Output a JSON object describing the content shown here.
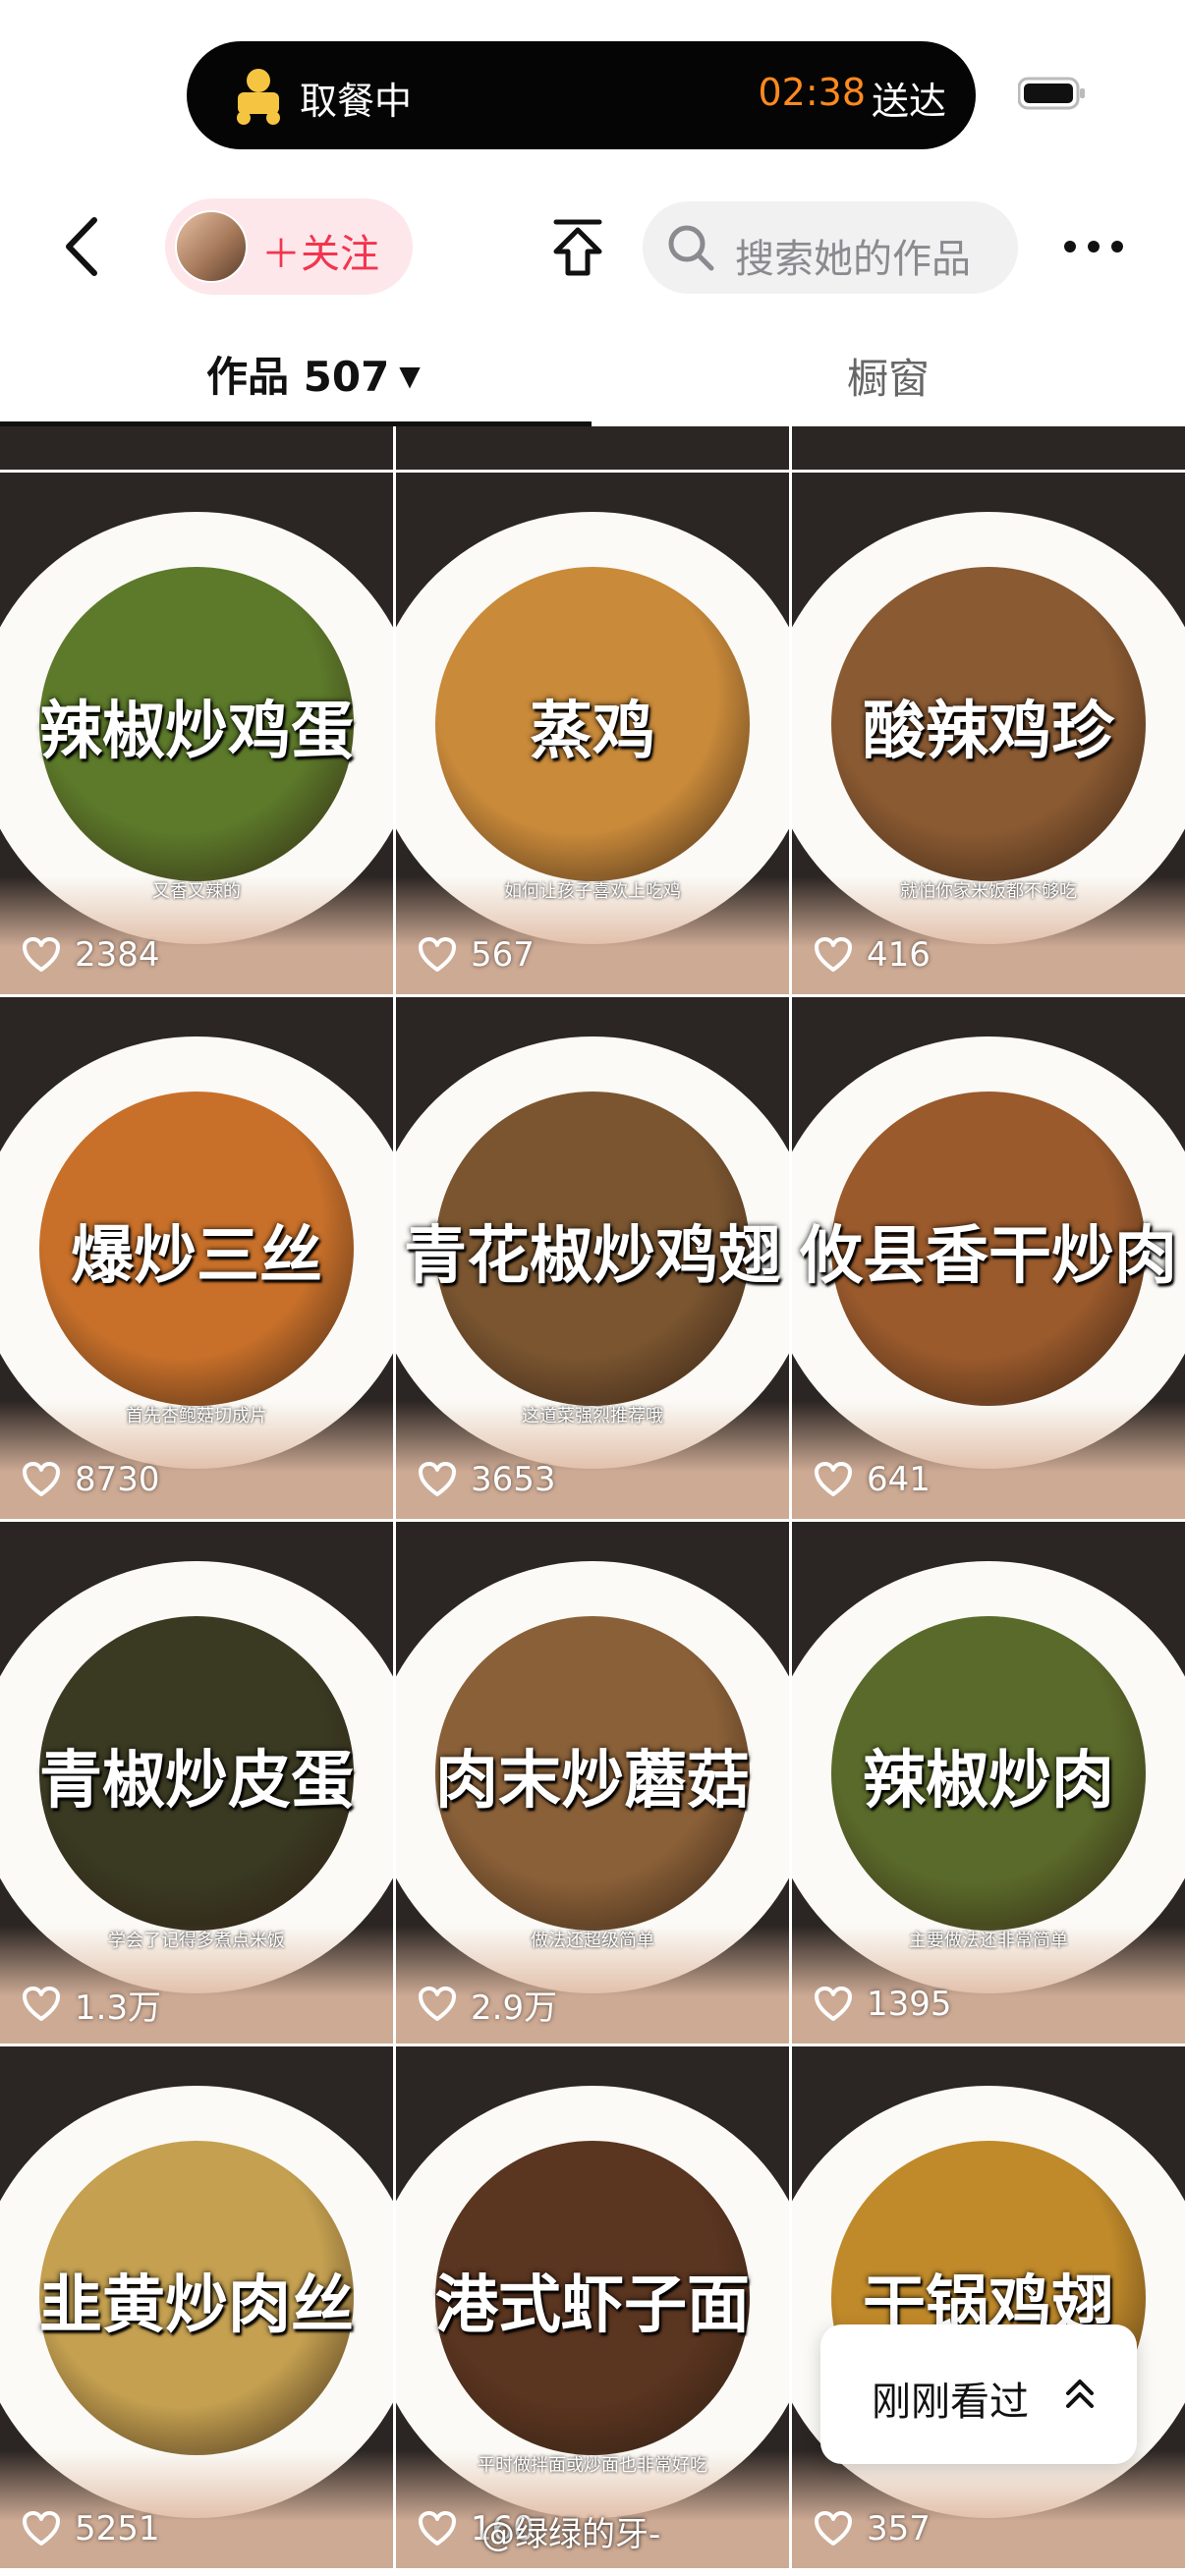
{
  "live_activity": {
    "status": "取餐中",
    "time": "02:38",
    "deliver_label": "送达",
    "time_color": "#ff8a1f"
  },
  "header": {
    "back_icon": "chevron-left-icon",
    "follow_label": "＋关注",
    "share_icon": "share-upload-icon",
    "search_placeholder": "搜索她的作品",
    "more_icon": "ellipsis-icon"
  },
  "tabs": {
    "works_label": "作品 507",
    "works_caret": "▼",
    "shop_label": "橱窗"
  },
  "videos": [
    {
      "title": "辣椒炒鸡蛋",
      "subtitle": "又香又辣的",
      "likes": "2384",
      "food_color": "#5c7a2a"
    },
    {
      "title": "蒸鸡",
      "subtitle": "如何让孩子喜欢上吃鸡",
      "likes": "567",
      "food_color": "#c98a3a"
    },
    {
      "title": "酸辣鸡珍",
      "subtitle": "就怕你家米饭都不够吃",
      "likes": "416",
      "food_color": "#8a5a32"
    },
    {
      "title": "爆炒三丝",
      "subtitle": "首先杏鲍菇切成片",
      "likes": "8730",
      "food_color": "#c8702a"
    },
    {
      "title": "青花椒炒鸡翅",
      "subtitle": "这道菜强烈推荐哦",
      "likes": "3653",
      "food_color": "#7a5530"
    },
    {
      "title": "攸县香干炒肉",
      "subtitle": "",
      "likes": "641",
      "food_color": "#9a5a2c"
    },
    {
      "title": "青椒炒皮蛋",
      "subtitle": "学会了记得多煮点米饭",
      "likes": "1.3万",
      "food_color": "#3a3a22"
    },
    {
      "title": "肉末炒蘑菇",
      "subtitle": "做法还超级简单",
      "likes": "2.9万",
      "food_color": "#8a6038"
    },
    {
      "title": "辣椒炒肉",
      "subtitle": "主要做法还非常简单",
      "likes": "1395",
      "food_color": "#5a6a2a"
    },
    {
      "title": "韭黄炒肉丝",
      "subtitle": "",
      "likes": "5251",
      "food_color": "#c4a050"
    },
    {
      "title": "港式虾子面",
      "subtitle": "平时做拌面或炒面也非常好吃",
      "likes": "160",
      "food_color": "#5a3520"
    },
    {
      "title": "干锅鸡翅",
      "subtitle": "",
      "likes": "357",
      "food_color": "#c08a2a"
    }
  ],
  "recent_button": {
    "label": "刚刚看过",
    "icon": "double-chevron-up-icon"
  },
  "watermark": "@绿绿的牙-"
}
